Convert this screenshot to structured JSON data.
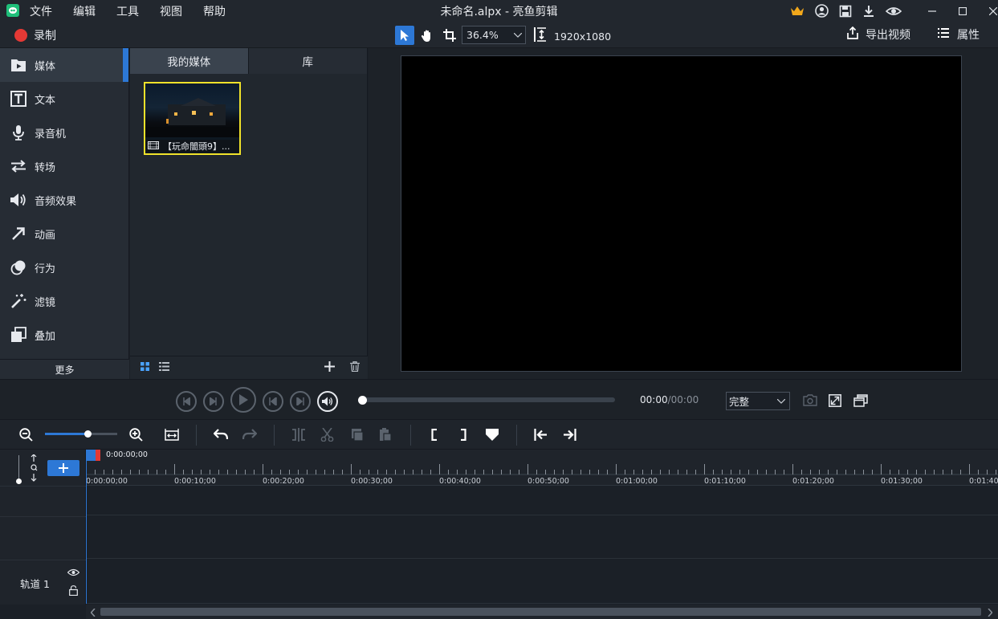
{
  "app": {
    "title": "未命名.alpx - 亮鱼剪辑",
    "menu": [
      "文件",
      "编辑",
      "工具",
      "视图",
      "帮助"
    ],
    "accent": "#2d78d6"
  },
  "toolbar": {
    "record_label": "录制",
    "zoom_value": "36.4%",
    "resolution": "1920x1080",
    "export_label": "导出视频",
    "properties_label": "属性"
  },
  "sidebar": {
    "items": [
      {
        "label": "媒体",
        "icon": "media-icon"
      },
      {
        "label": "文本",
        "icon": "text-icon"
      },
      {
        "label": "录音机",
        "icon": "microphone-icon"
      },
      {
        "label": "转场",
        "icon": "transition-icon"
      },
      {
        "label": "音频效果",
        "icon": "speaker-icon"
      },
      {
        "label": "动画",
        "icon": "arrow-icon"
      },
      {
        "label": "行为",
        "icon": "behavior-icon"
      },
      {
        "label": "滤镜",
        "icon": "magic-wand-icon"
      },
      {
        "label": "叠加",
        "icon": "overlay-icon"
      }
    ],
    "more_label": "更多"
  },
  "media": {
    "tabs": [
      "我的媒体",
      "库"
    ],
    "clip_name": "【玩命闇頭9】..."
  },
  "player": {
    "time_current": "00:00",
    "time_total": "00:00",
    "quality": "完整"
  },
  "timeline": {
    "playhead_time": "0:00:00;00",
    "ruler": [
      "0:00:00;00",
      "0:00:10;00",
      "0:00:20;00",
      "0:00:30;00",
      "0:00:40;00",
      "0:00:50;00",
      "0:01:00;00",
      "0:01:10;00",
      "0:01:20;00",
      "0:01:30;00",
      "0:01:40"
    ],
    "track_label": "轨道 1"
  }
}
